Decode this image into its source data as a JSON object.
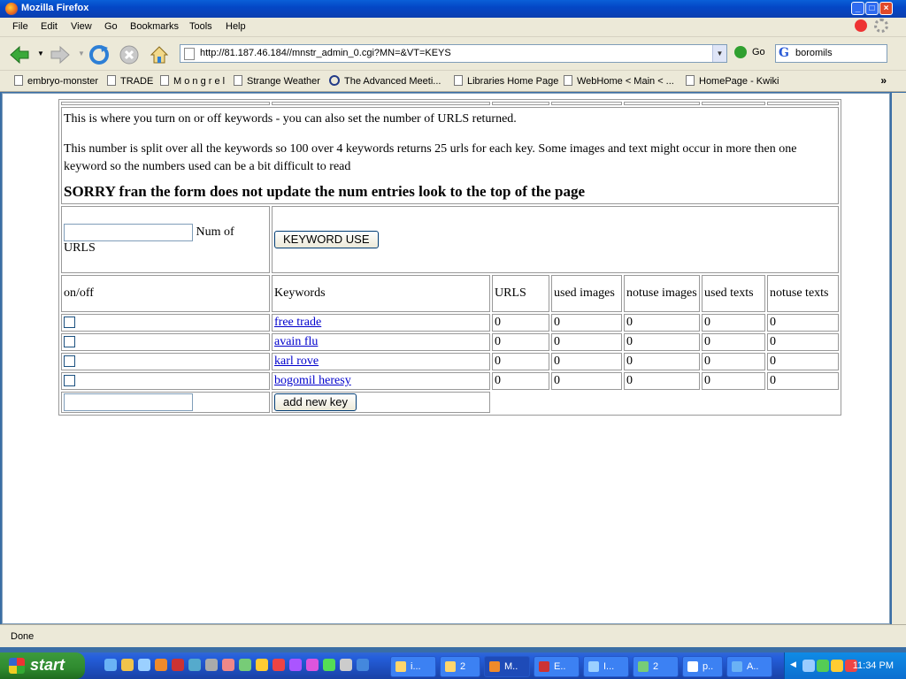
{
  "window": {
    "title": "Mozilla Firefox"
  },
  "menu": [
    "File",
    "Edit",
    "View",
    "Go",
    "Bookmarks",
    "Tools",
    "Help"
  ],
  "navbar": {
    "url": "http://81.187.46.184//mnstr_admin_0.cgi?MN=&VT=KEYS",
    "go_label": "Go",
    "search_value": "boromils"
  },
  "bookmarks": [
    "embryo-monster",
    "TRADE",
    "M o n g r e l",
    "Strange Weather",
    "The Advanced Meeti...",
    "Libraries Home Page",
    "WebHome < Main < ...",
    "HomePage - Kwiki"
  ],
  "page": {
    "intro1": "This is where you turn on or off keywords - you can also set the number of URLS returned.",
    "intro2": "This number is split over all the keywords so 100 over 4 keywords returns 25 urls for each key. Some images and text might occur in more then one keyword so the numbers used can be a bit difficult to read",
    "sorry": "SORRY fran the form does not update the num entries look to the top of the page",
    "num_urls_label": "Num of URLS",
    "keyword_use_button": "KEYWORD USE",
    "headers": [
      "on/off",
      "Keywords",
      "URLS",
      "used images",
      "notuse images",
      "used texts",
      "notuse texts"
    ],
    "rows": [
      {
        "keyword": "free trade",
        "urls": "0",
        "used_images": "0",
        "notuse_images": "0",
        "used_texts": "0",
        "notuse_texts": "0"
      },
      {
        "keyword": "avain flu",
        "urls": "0",
        "used_images": "0",
        "notuse_images": "0",
        "used_texts": "0",
        "notuse_texts": "0"
      },
      {
        "keyword": "karl rove",
        "urls": "0",
        "used_images": "0",
        "notuse_images": "0",
        "used_texts": "0",
        "notuse_texts": "0"
      },
      {
        "keyword": "bogomil heresy",
        "urls": "0",
        "used_images": "0",
        "notuse_images": "0",
        "used_texts": "0",
        "notuse_texts": "0"
      }
    ],
    "add_key_button": "add new key"
  },
  "status": {
    "text": "Done"
  },
  "taskbar": {
    "start_label": "start",
    "tasks": [
      "i...",
      "2",
      "M..",
      "E..",
      "I...",
      "2",
      "p..",
      "A.."
    ],
    "clock": "11:34 PM"
  }
}
